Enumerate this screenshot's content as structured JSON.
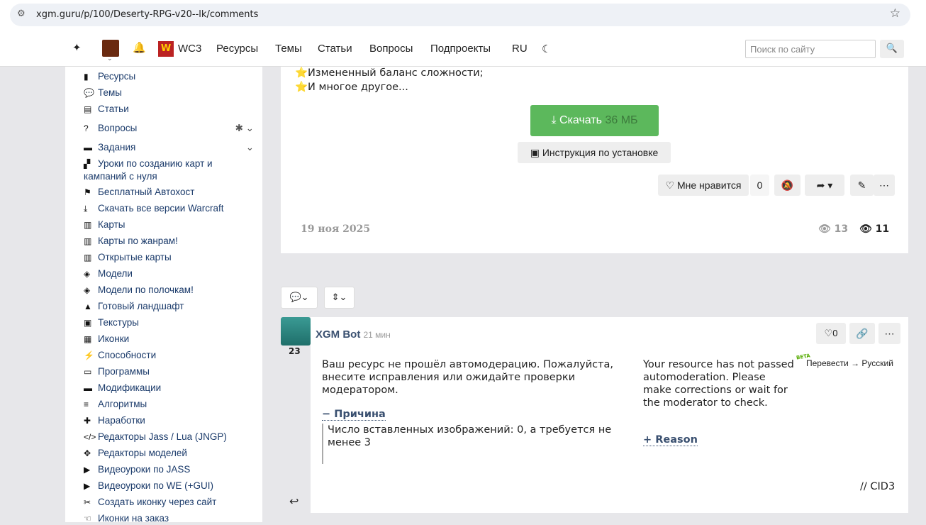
{
  "browser": {
    "url": "xgm.guru/p/100/Deserty-RPG-v20--lk/comments"
  },
  "nav": {
    "wc3": "WC3",
    "items": [
      "Ресурсы",
      "Темы",
      "Статьи",
      "Вопросы",
      "Подпроекты",
      "RU"
    ],
    "search_placeholder": "Поиск по сайту"
  },
  "sidebar": {
    "items": [
      {
        "icon": "▮",
        "label": "Ресурсы"
      },
      {
        "icon": "💬",
        "label": "Темы"
      },
      {
        "icon": "▤",
        "label": "Статьи"
      },
      {
        "icon": "?",
        "label": "Вопросы"
      },
      {
        "icon": "▬",
        "label": "Задания"
      },
      {
        "icon": "▞",
        "label": "Уроки по созданию карт и кампаний с нуля"
      },
      {
        "icon": "⚑",
        "label": "Бесплатный Автохост"
      },
      {
        "icon": "⤓",
        "label": "Скачать все версии Warcraft"
      },
      {
        "icon": "▥",
        "label": "Карты"
      },
      {
        "icon": "▥",
        "label": "Карты по жанрам!"
      },
      {
        "icon": "▥",
        "label": "Открытые карты"
      },
      {
        "icon": "◈",
        "label": "Модели"
      },
      {
        "icon": "◈",
        "label": "Модели по полочкам!"
      },
      {
        "icon": "▲",
        "label": "Готовый ландшафт"
      },
      {
        "icon": "▣",
        "label": "Текстуры"
      },
      {
        "icon": "▦",
        "label": "Иконки"
      },
      {
        "icon": "⚡",
        "label": "Способности"
      },
      {
        "icon": "▭",
        "label": "Программы"
      },
      {
        "icon": "▬",
        "label": "Модификации"
      },
      {
        "icon": "≡",
        "label": "Алгоритмы"
      },
      {
        "icon": "✚",
        "label": "Наработки"
      },
      {
        "icon": "</>",
        "label": "Редакторы Jass / Lua (JNGP)"
      },
      {
        "icon": "✥",
        "label": "Редакторы моделей"
      },
      {
        "icon": "▶",
        "label": "Видеоуроки по JASS"
      },
      {
        "icon": "▶",
        "label": "Видеоуроки по WE (+GUI)"
      },
      {
        "icon": "✂",
        "label": "Создать иконку через сайт"
      },
      {
        "icon": "☜",
        "label": "Иконки на заказ"
      }
    ]
  },
  "post": {
    "lines": [
      "⭐Измененный баланс сложности;",
      "⭐И многое другое..."
    ],
    "download_label": "Скачать",
    "download_size": "36 МБ",
    "install_label": "Инструкция по установке",
    "like_label": "Мне нравится",
    "like_count": "0",
    "date": "19 ноя 2025",
    "views_a": "13",
    "views_b": "11"
  },
  "comment": {
    "author": "XGM Bot",
    "time": "21 мин",
    "level": "23",
    "likes": "0",
    "text_ru": "Ваш ресурс не прошёл автомодерацию. Пожалуйста, внесите исправления или ожидайте проверки модератором.",
    "reason_ru": "− Причина",
    "reason_text": "Число вставленных изображений: 0, а требуется не менее 3",
    "text_en": "Your resource has not passed automoderation. Please make corrections or wait for the moderator to check.",
    "reason_en": "+ Reason",
    "beta": "BETA",
    "translate": "Перевести → Русский",
    "cid": "// CID3"
  }
}
